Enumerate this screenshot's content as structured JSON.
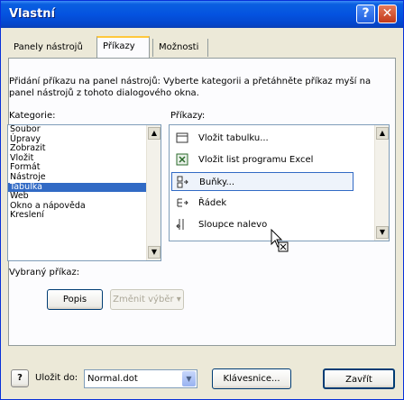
{
  "window": {
    "title": "Vlastní"
  },
  "titlebar_buttons": {
    "help": "?",
    "close": "✕"
  },
  "tabs": [
    {
      "label": "Panely nástrojů",
      "active": false
    },
    {
      "label": "Příkazy",
      "active": true
    },
    {
      "label": "Možnosti",
      "active": false
    }
  ],
  "description": "Přidání příkazu na panel nástrojů: Vyberte kategorii a přetáhněte příkaz myší na panel nástrojů z tohoto dialogového okna.",
  "categories": {
    "label": "Kategorie:",
    "items": [
      "Soubor",
      "Úpravy",
      "Zobrazit",
      "Vložit",
      "Formát",
      "Nástroje",
      "Tabulka",
      "Web",
      "Okno a nápověda",
      "Kreslení"
    ],
    "selected": "Tabulka"
  },
  "commands": {
    "label": "Příkazy:",
    "items": [
      {
        "label": "Vložit tabulku...",
        "icon": "table-icon"
      },
      {
        "label": "Vložit list programu Excel",
        "icon": "excel-sheet-icon"
      },
      {
        "label": "Buňky...",
        "icon": "cells-icon"
      },
      {
        "label": "Řádek",
        "icon": "row-icon"
      },
      {
        "label": "Sloupce nalevo",
        "icon": "columns-left-icon"
      }
    ],
    "selected": "Buňky..."
  },
  "selected_command": {
    "label": "Vybraný příkaz:",
    "describe_button": "Popis",
    "modify_button": "Změnit výběr"
  },
  "footer": {
    "help_icon": "?",
    "save_in_label": "Uložit do:",
    "save_in_value": "Normal.dot",
    "keyboard_button": "Klávesnice...",
    "close_button": "Zavřít"
  },
  "colors": {
    "title_bar": "#0453e0",
    "selection": "#316ac5",
    "dialog_bg": "#ece9d8"
  }
}
